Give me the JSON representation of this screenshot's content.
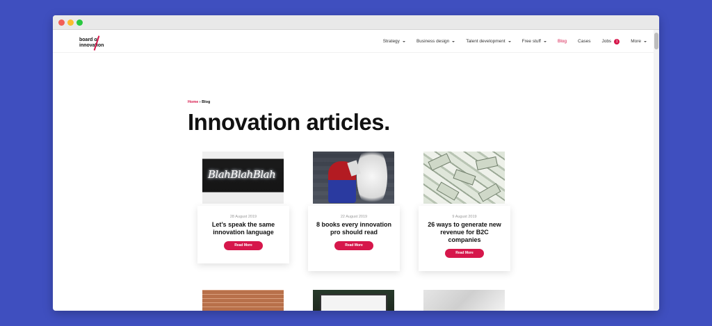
{
  "logo": {
    "line1": "board of",
    "line2": "innovation"
  },
  "nav": {
    "items": [
      {
        "label": "Strategy",
        "dropdown": true
      },
      {
        "label": "Business design",
        "dropdown": true
      },
      {
        "label": "Talent development",
        "dropdown": true
      },
      {
        "label": "Free stuff",
        "dropdown": true
      },
      {
        "label": "Blog",
        "active": true
      },
      {
        "label": "Cases"
      },
      {
        "label": "Jobs",
        "badge": "1"
      },
      {
        "label": "More",
        "dropdown": true
      }
    ]
  },
  "breadcrumb": {
    "home": "Home",
    "sep": " › ",
    "current": "Blog"
  },
  "page": {
    "title": "Innovation articles."
  },
  "articles": [
    {
      "date": "28 August 2019",
      "title": "Let’s speak the same innovation language",
      "cta": "Read More",
      "image_label": "BlahBlahBlah"
    },
    {
      "date": "22 August 2019",
      "title": "8 books every innovation pro should read",
      "cta": "Read More"
    },
    {
      "date": "9 August 2019",
      "title": "26 ways to generate new revenue for B2C companies",
      "cta": "Read More"
    }
  ],
  "colors": {
    "accent": "#d6174b",
    "background": "#3f4fbf"
  }
}
